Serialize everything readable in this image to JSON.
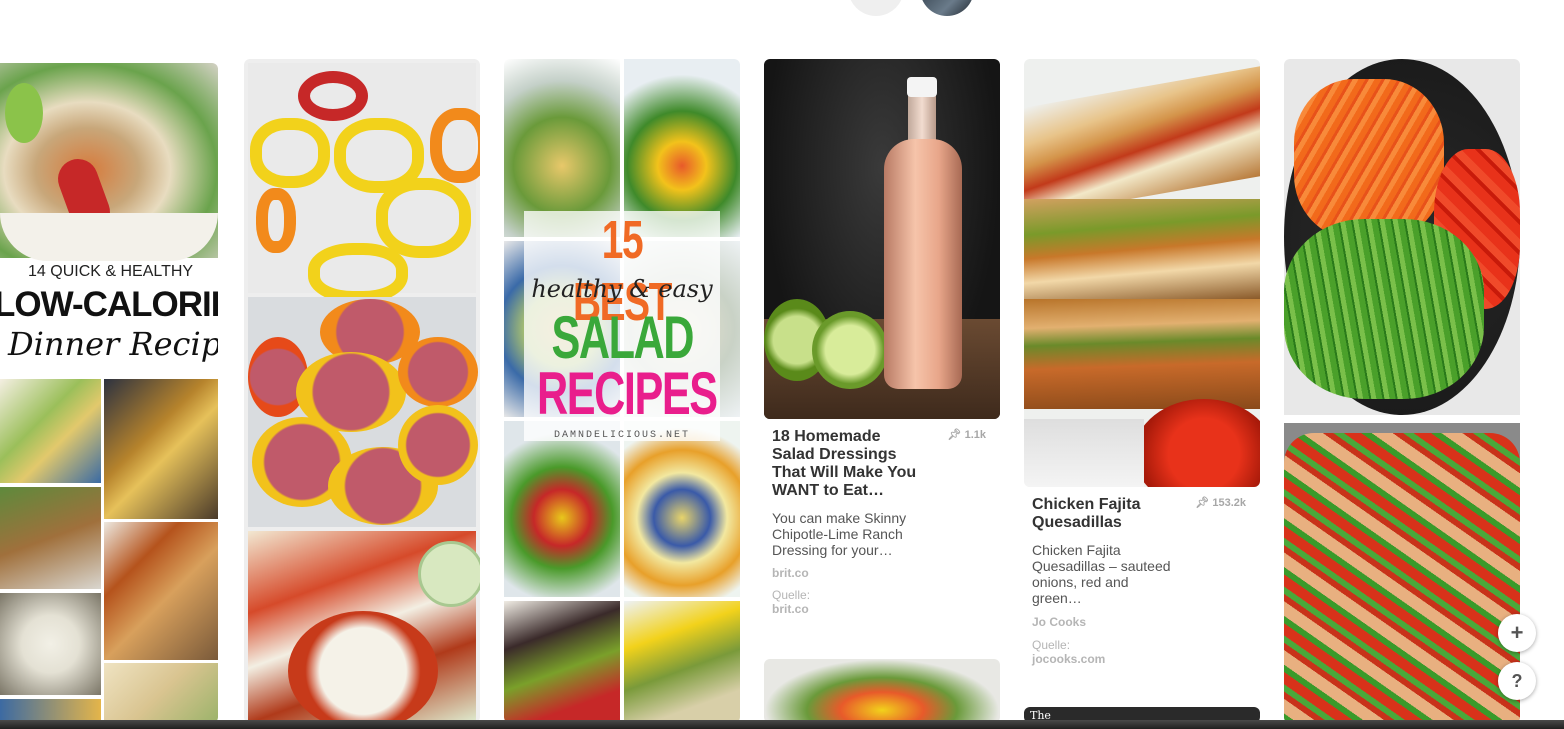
{
  "pins": [
    {
      "id": "low-calorie",
      "overlay": {
        "line1": "14 QUICK & HEALTHY",
        "line2": "LOW-CALORIE",
        "line3": "Dinner Recipes"
      }
    },
    {
      "id": "stuffed-peppers"
    },
    {
      "id": "salads",
      "overlay": {
        "line1": "15 BEST",
        "line2": "healthy & easy",
        "line3": "SALAD",
        "line4": "RECIPES",
        "line5": "DAMNDELICIOUS.NET"
      }
    },
    {
      "id": "dressing",
      "title": "18 Homemade Salad Dressings That Will Make You WANT to Eat…",
      "repins": "1.1k",
      "description": "You can make Skinny Chipotle-Lime Ranch Dressing for your…",
      "domain": "brit.co",
      "source_label": "Quelle:",
      "source": "brit.co"
    },
    {
      "id": "quesadillas",
      "title": "Chicken Fajita Quesadillas",
      "repins": "153.2k",
      "description": "Chicken Fajita Quesadillas – sauteed onions, red and green…",
      "author": "Jo Cooks",
      "source_label": "Quelle:",
      "source": "jocooks.com"
    },
    {
      "id": "veggies"
    },
    {
      "id": "bottom-card",
      "brand": "The"
    }
  ],
  "fab": {
    "plus": "+",
    "help": "?"
  },
  "icons": {
    "pin": "pin-icon"
  },
  "colors": {
    "accent": "#e60023",
    "text": "#333333",
    "muted": "#a7a7a7"
  }
}
